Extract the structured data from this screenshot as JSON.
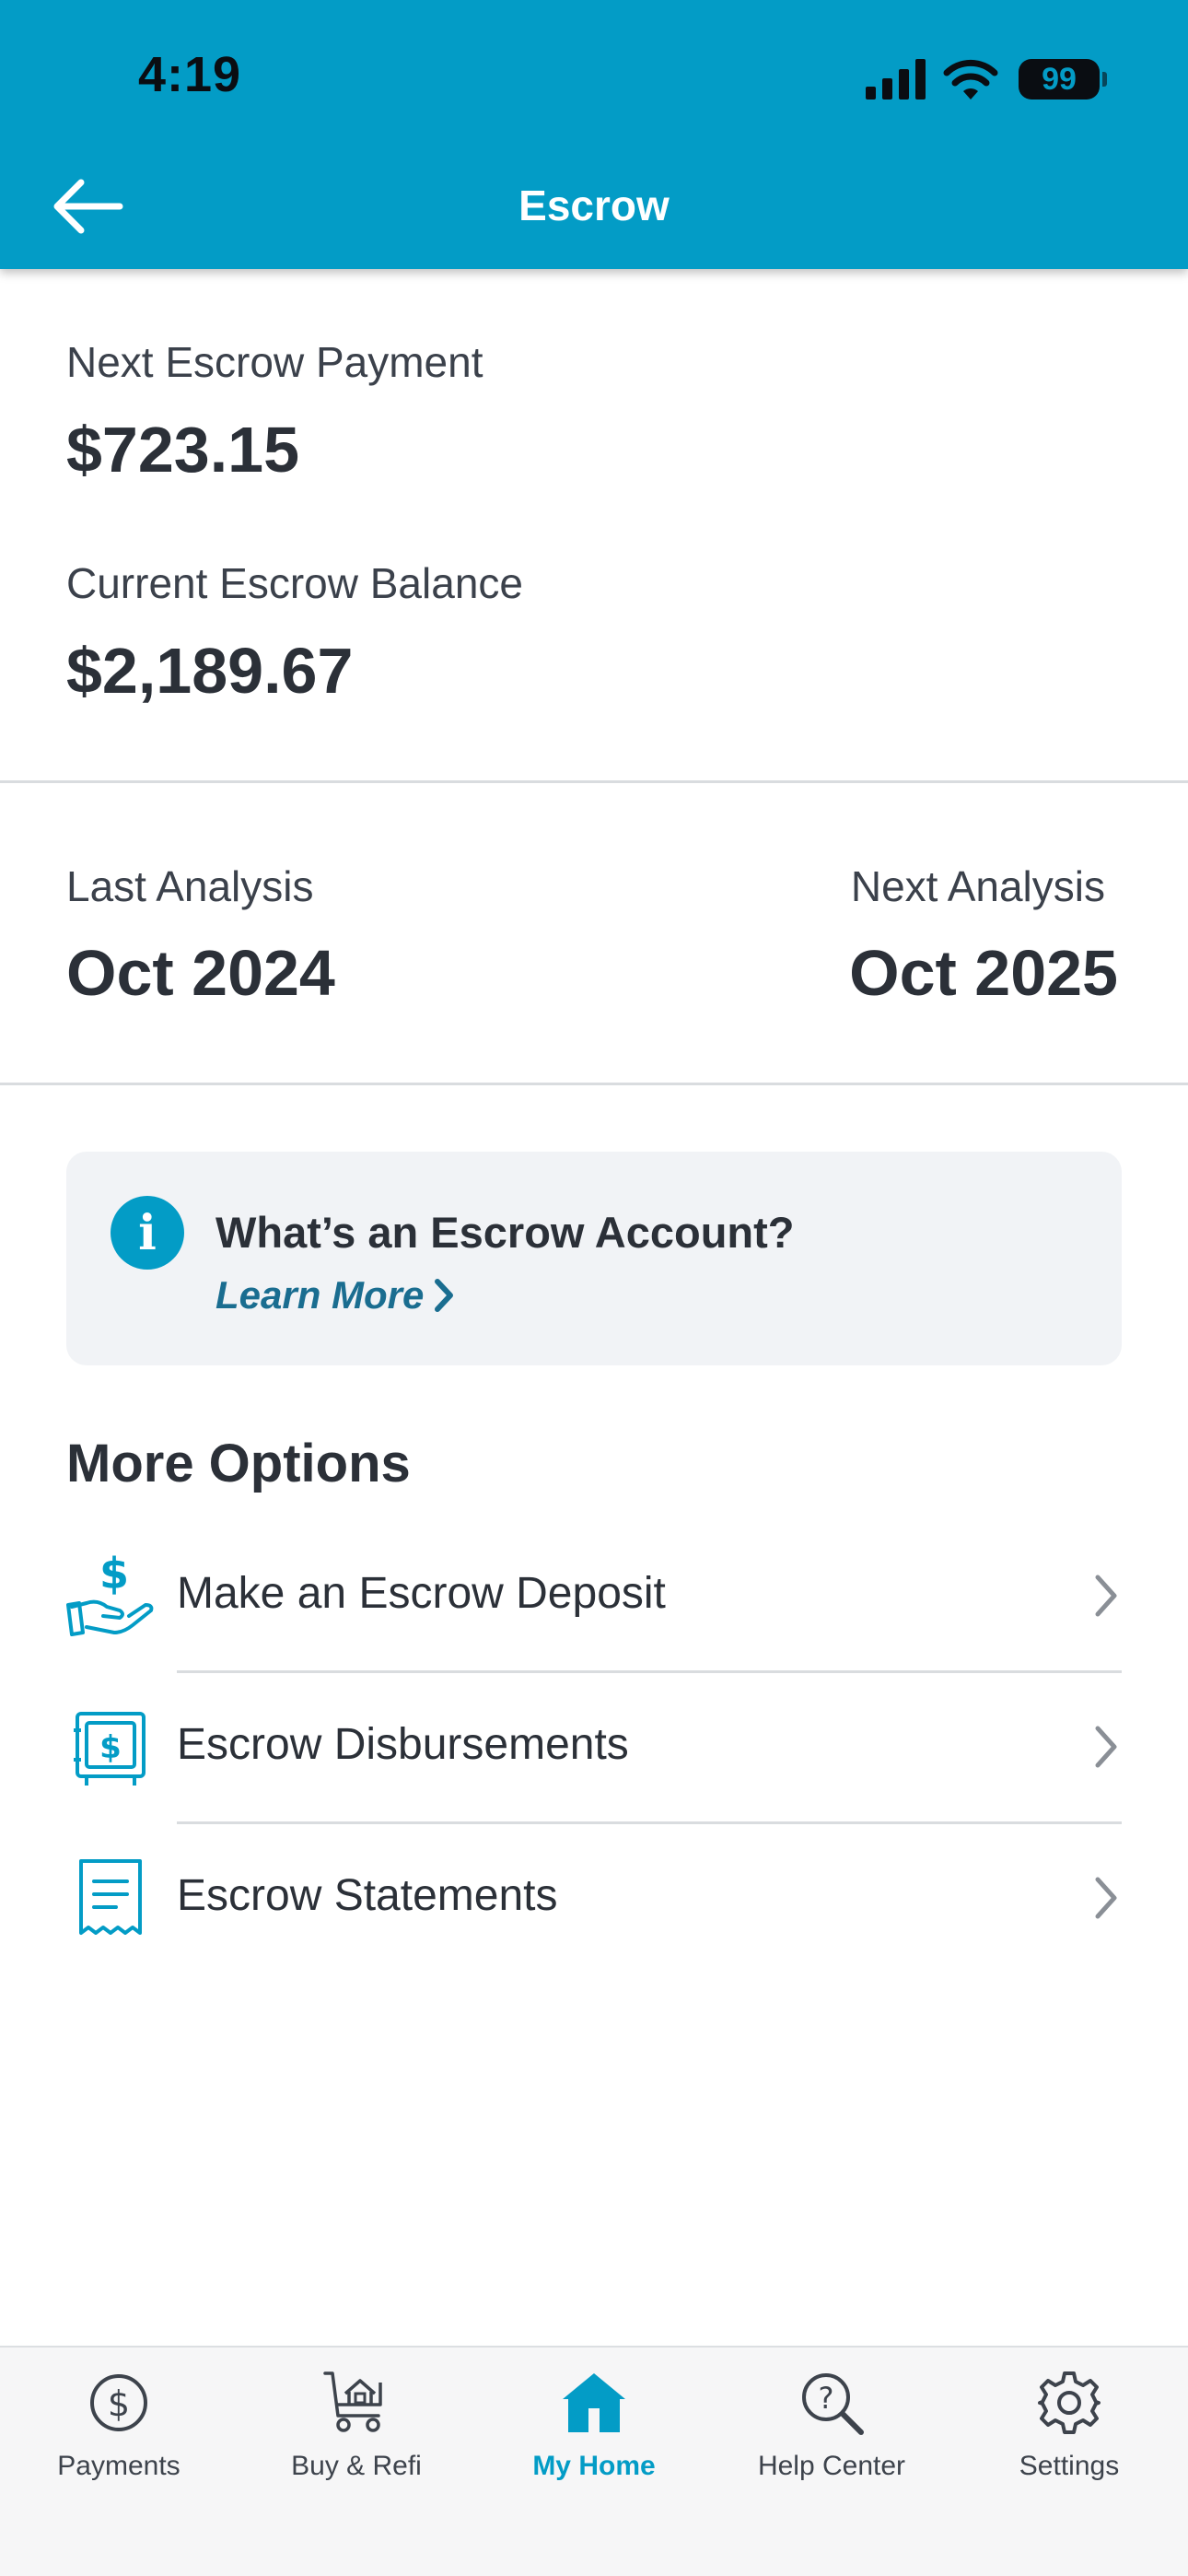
{
  "status_bar": {
    "time": "4:19",
    "battery": "99"
  },
  "nav": {
    "title": "Escrow",
    "back_icon": "arrow-left-icon"
  },
  "summary": {
    "next_payment_label": "Next Escrow Payment",
    "next_payment_amount": "$723.15",
    "balance_label": "Current Escrow Balance",
    "balance_amount": "$2,189.67"
  },
  "analysis": {
    "last_label": "Last Analysis",
    "last_value": "Oct 2024",
    "next_label": "Next Analysis",
    "next_value": "Oct 2025"
  },
  "info_card": {
    "icon": "info-icon",
    "title": "What’s an Escrow Account?",
    "link_label": "Learn More"
  },
  "more_options": {
    "title": "More Options",
    "items": [
      {
        "label": "Make an Escrow Deposit",
        "icon": "hand-dollar-icon"
      },
      {
        "label": "Escrow Disbursements",
        "icon": "safe-icon"
      },
      {
        "label": "Escrow Statements",
        "icon": "receipt-icon"
      }
    ]
  },
  "tabbar": {
    "active": "My Home",
    "items": [
      {
        "label": "Payments",
        "icon": "dollar-circle-icon"
      },
      {
        "label": "Buy & Refi",
        "icon": "cart-house-icon"
      },
      {
        "label": "My Home",
        "icon": "home-icon"
      },
      {
        "label": "Help Center",
        "icon": "help-search-icon"
      },
      {
        "label": "Settings",
        "icon": "gear-icon"
      }
    ]
  },
  "colors": {
    "brand": "#039cc6",
    "text": "#2b3038",
    "link": "#1a6d90",
    "card_bg": "#f1f3f6",
    "divider": "#d9dcdf"
  }
}
